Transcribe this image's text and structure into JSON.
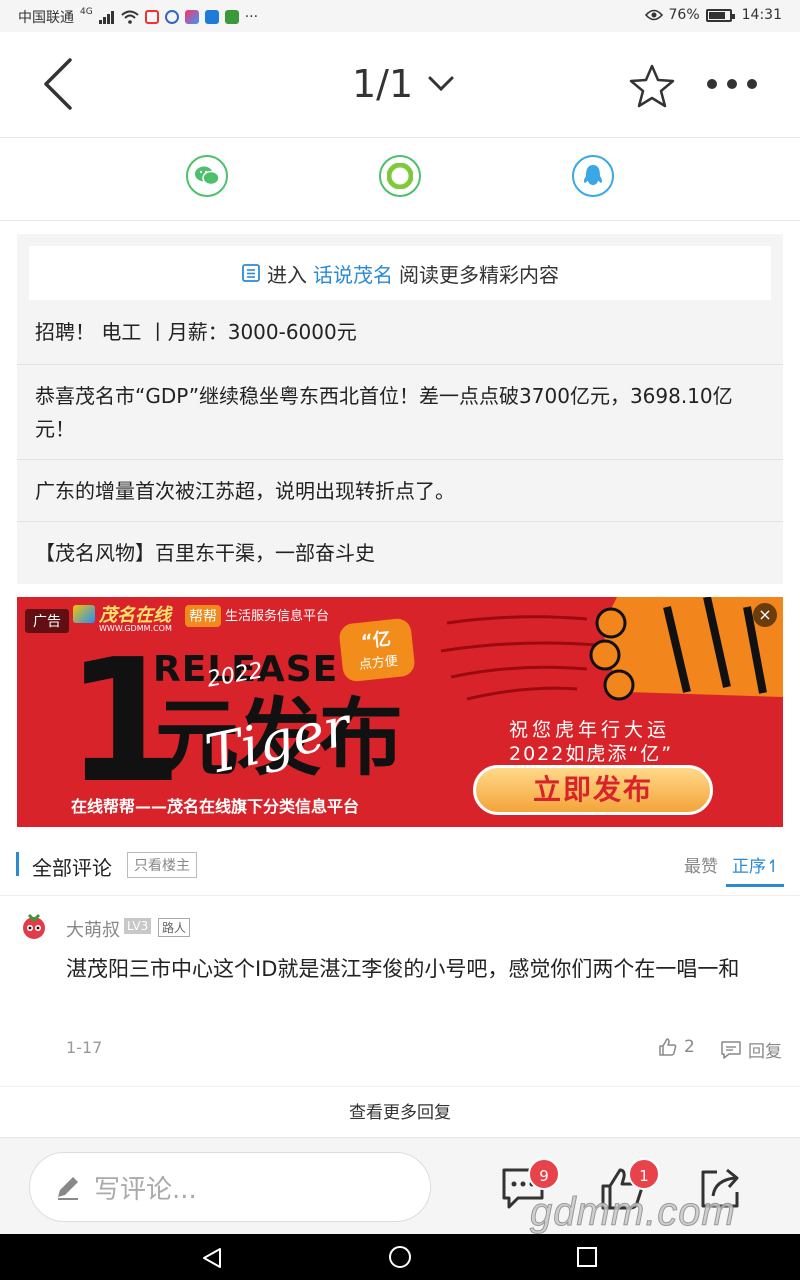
{
  "status_bar": {
    "carrier": "中国联通",
    "network": "4G",
    "battery": "76%",
    "time": "14:31",
    "more": "···"
  },
  "top_nav": {
    "page_indicator": "1/1"
  },
  "related": {
    "enter_prefix": "进入",
    "enter_link": "话说茂名",
    "enter_suffix": "阅读更多精彩内容",
    "items": [
      "招聘！ 电工 丨月薪：3000-6000元",
      "恭喜茂名市“GDP”继续稳坐粤东西北首位！差一点点破3700亿元，3698.10亿元！",
      "广东的增量首次被江苏超，说明出现转折点了。",
      "【茂名风物】百里东干渠，一部奋斗史"
    ]
  },
  "ad": {
    "badge": "广告",
    "brand": "茂名在线",
    "brand_url": "WWW.GDMM.COM",
    "sub_brand": "帮帮",
    "platform": "生活服务信息平台",
    "yi_badge_top": "“亿",
    "yi_badge_bottom": "点方便",
    "release": "RELEASE",
    "year": "2022",
    "headline_num": "1",
    "headline_text": "元发布",
    "tiger": "Tiger",
    "footer": "在线帮帮——茂名在线旗下分类信息平台",
    "wish_line1": "祝您虎年行大运",
    "wish_line2": "2022如虎添“亿”",
    "cta": "立即发布",
    "close": "×"
  },
  "comments_header": {
    "title": "全部评论",
    "only_op": "只看楼主",
    "sort_hot": "最赞",
    "sort_order": "正序↿"
  },
  "comment": {
    "username": "大萌叔",
    "level": "LV3",
    "role": "路人",
    "text": "湛茂阳三市中心这个ID就是湛江李俊的小号吧，感觉你们两个在一唱一和",
    "date": "1-17",
    "likes": "2",
    "reply": "回复"
  },
  "more_replies": "查看更多回复",
  "bottom_bar": {
    "write_placeholder": "写评论...",
    "comments_count": "9",
    "likes_count": "1"
  },
  "watermark": "gdmm.com"
}
